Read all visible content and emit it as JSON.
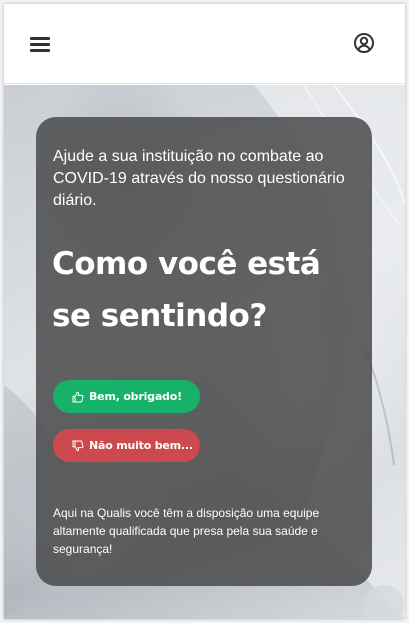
{
  "header": {
    "menu_icon": "hamburger-menu-icon",
    "profile_icon": "user-circle-icon"
  },
  "hero": {
    "intro": "Ajude a sua instituição no combate ao COVID-19 através do nosso questionário diário.",
    "question": "Como você está se sentindo?",
    "good_button_label": "Bem, obrigado!",
    "good_button_icon": "thumbs-up-icon",
    "bad_button_label": "Não muito bem...",
    "bad_button_icon": "thumbs-down-icon",
    "footer": "Aqui na Qualis você têm a disposição uma equipe altamente qualificada que presa pela sua saúde e segurança!"
  },
  "colors": {
    "good": "#17b26a",
    "bad": "#cc4a4e",
    "card": "#4a4a4c"
  }
}
